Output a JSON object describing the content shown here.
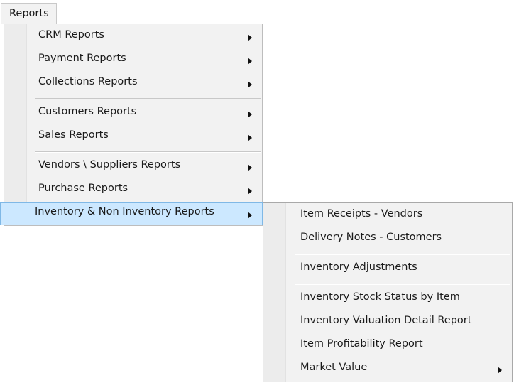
{
  "menubar": {
    "reports_label": "Reports"
  },
  "main_menu": {
    "items": [
      {
        "label": "CRM Reports"
      },
      {
        "label": "Payment Reports"
      },
      {
        "label": "Collections Reports"
      },
      {
        "label": "Customers Reports"
      },
      {
        "label": "Sales Reports"
      },
      {
        "label": "Vendors \\ Suppliers Reports"
      },
      {
        "label": "Purchase Reports"
      },
      {
        "label": "Inventory & Non Inventory Reports"
      }
    ]
  },
  "sub_menu": {
    "items": [
      {
        "label": "Item Receipts - Vendors"
      },
      {
        "label": "Delivery Notes - Customers"
      },
      {
        "label": "Inventory Adjustments"
      },
      {
        "label": "Inventory Stock Status by Item"
      },
      {
        "label": "Inventory Valuation Detail Report"
      },
      {
        "label": "Item Profitability Report"
      },
      {
        "label": "Market Value"
      }
    ]
  },
  "colors": {
    "highlight": "#cce8ff",
    "highlight_border": "#7fb8e6",
    "menu_bg": "#f2f2f2"
  }
}
